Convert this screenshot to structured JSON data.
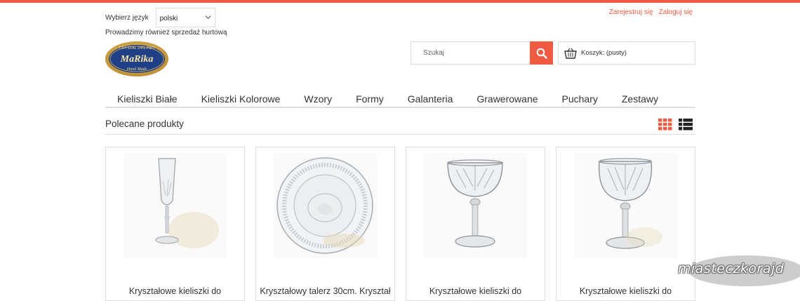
{
  "colors": {
    "accent": "#ee5a42",
    "border": "#dddddd"
  },
  "header": {
    "language_label": "Wybierz język",
    "language_value": "polski",
    "wholesale_text": "Prowadzimy również sprzedaż hurtową",
    "register_link": "Zarejestruj się",
    "login_link": "Zaloguj się",
    "logo": {
      "top_text": "CRYSTAL 24% PBO",
      "brand": "MaRika",
      "bottom_text": "Hand Made"
    },
    "search_placeholder": "Szukaj",
    "cart_text": "Koszyk: (pusty)"
  },
  "nav": {
    "items": [
      "Kieliszki Białe",
      "Kieliszki Kolorowe",
      "Wzory",
      "Formy",
      "Galanteria",
      "Grawerowane",
      "Puchary",
      "Zestawy"
    ]
  },
  "section": {
    "title": "Polecane produkty",
    "grid_icon": "grid-view-icon",
    "list_icon": "list-view-icon"
  },
  "products": [
    {
      "title": "Kryształowe kieliszki do",
      "image": "champagne-flute"
    },
    {
      "title": "Kryształowy talerz 30cm. Kryształ",
      "image": "crystal-plate"
    },
    {
      "title": "Kryształowe kieliszki do",
      "image": "coupe-glass"
    },
    {
      "title": "Kryształowe kieliszki do",
      "image": "coupe-glass"
    }
  ],
  "watermark": {
    "text": "miasteczkorajd"
  }
}
